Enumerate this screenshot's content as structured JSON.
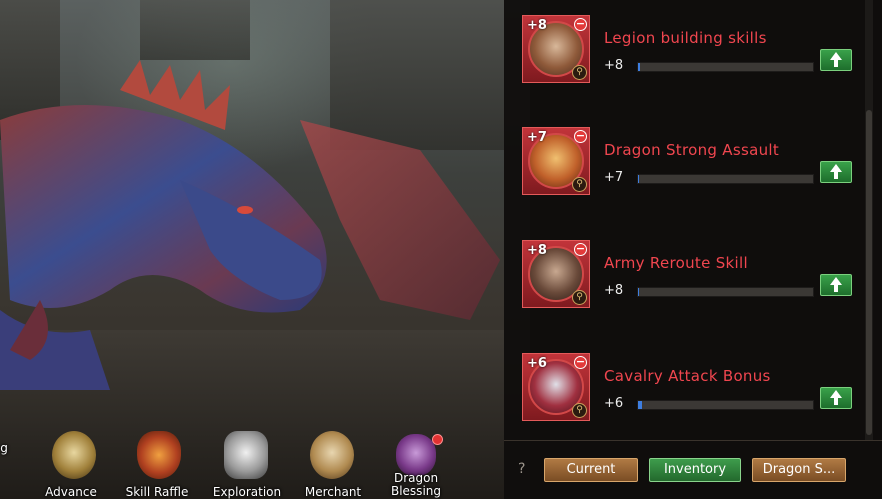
{
  "skills": [
    {
      "level_badge": "+8",
      "name": "Legion building skills",
      "value": "+8",
      "progress": 0.01
    },
    {
      "level_badge": "+7",
      "name": "Dragon Strong Assault",
      "value": "+7",
      "progress": 0.0
    },
    {
      "level_badge": "+8",
      "name": "Army Reroute Skill",
      "value": "+8",
      "progress": 0.0
    },
    {
      "level_badge": "+6",
      "name": "Cavalry Attack Bonus",
      "value": "+6",
      "progress": 0.02
    }
  ],
  "footer": {
    "help_label": "?",
    "current_label": "Current",
    "inventory_label": "Inventory",
    "dragon_label": "Dragon S..."
  },
  "bottom_nav": {
    "left_partial_label": "g",
    "items": [
      {
        "label": "Advance",
        "icon": "dragon-head-icon"
      },
      {
        "label": "Skill Raffle",
        "icon": "flame-shield-icon"
      },
      {
        "label": "Exploration",
        "icon": "winged-scroll-icon"
      },
      {
        "label": "Merchant",
        "icon": "horned-crest-icon"
      },
      {
        "label": "Dragon Blessing",
        "icon": "dragon-egg-icon"
      }
    ]
  },
  "colors": {
    "skill_name": "#f0464f",
    "upgrade_button": "#39a14a",
    "progress_fill": "#3e7ee0"
  }
}
